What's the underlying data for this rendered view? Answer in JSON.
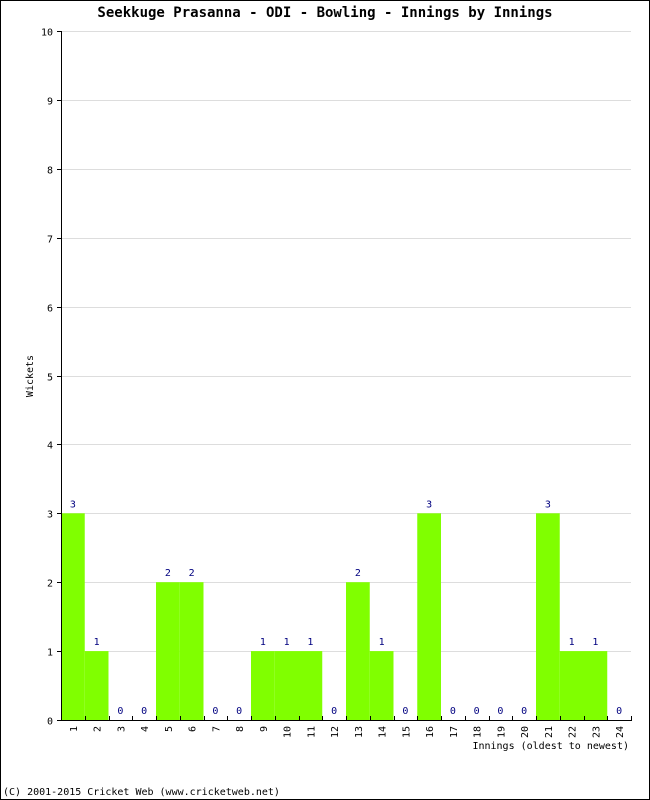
{
  "chart_data": {
    "type": "bar",
    "title": "Seekkuge Prasanna - ODI - Bowling - Innings by Innings",
    "xlabel": "Innings (oldest to newest)",
    "ylabel": "Wickets",
    "categories": [
      "1",
      "2",
      "3",
      "4",
      "5",
      "6",
      "7",
      "8",
      "9",
      "10",
      "11",
      "12",
      "13",
      "14",
      "15",
      "16",
      "17",
      "18",
      "19",
      "20",
      "21",
      "22",
      "23",
      "24"
    ],
    "values": [
      3,
      1,
      0,
      0,
      2,
      2,
      0,
      0,
      1,
      1,
      1,
      0,
      2,
      1,
      0,
      3,
      0,
      0,
      0,
      0,
      3,
      1,
      1,
      0
    ],
    "ylim": [
      0,
      10
    ],
    "yticks": [
      0,
      1,
      2,
      3,
      4,
      5,
      6,
      7,
      8,
      9,
      10
    ],
    "grid": true,
    "bar_color": "#80ff00",
    "label_color": "#000080"
  },
  "footer": "(C) 2001-2015 Cricket Web (www.cricketweb.net)"
}
